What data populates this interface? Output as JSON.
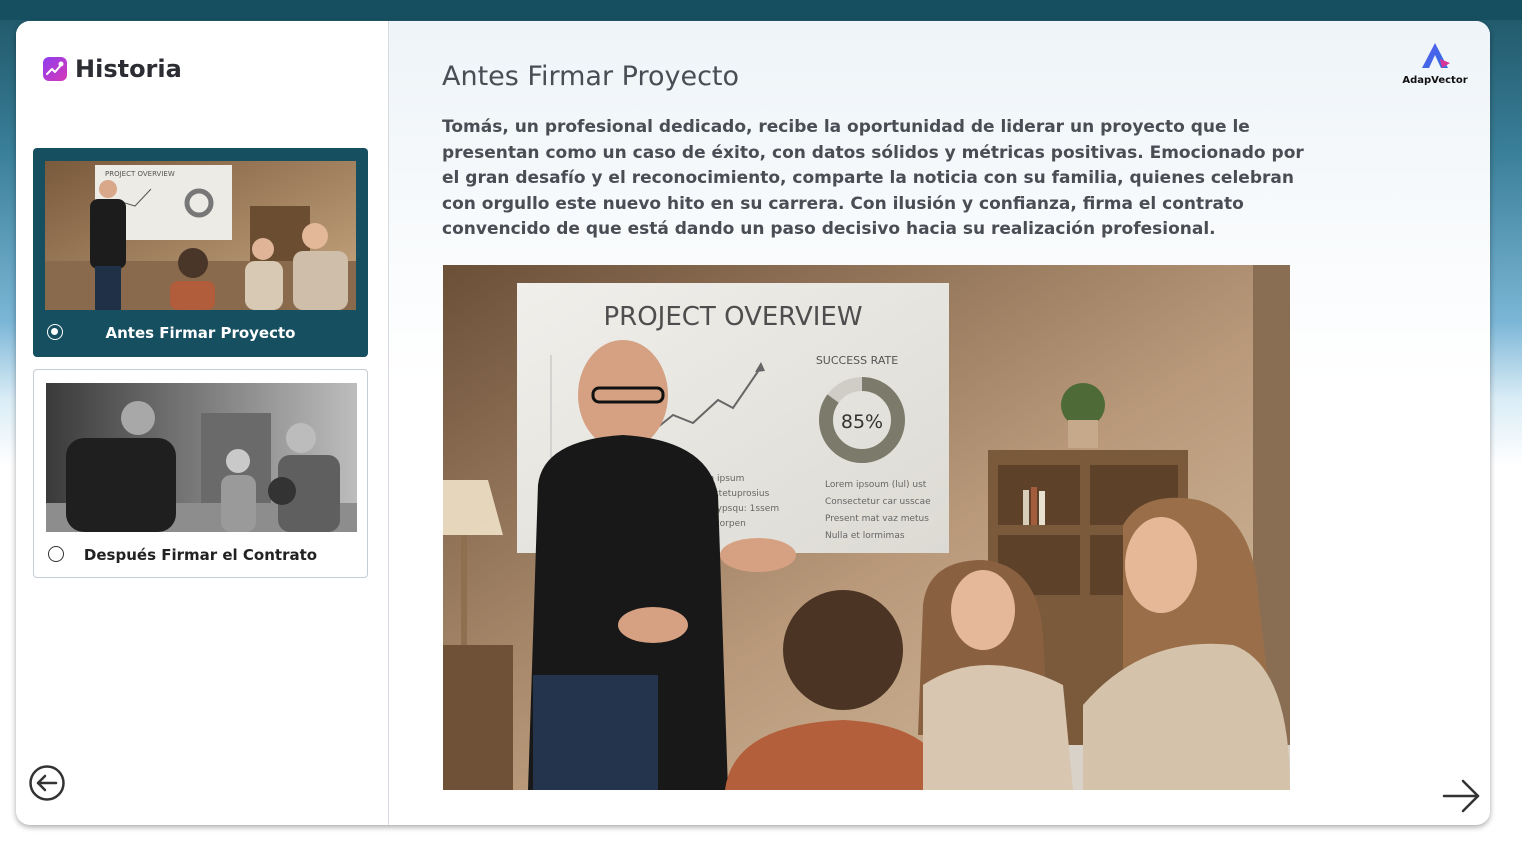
{
  "app": {
    "title": "Historia"
  },
  "scenes": [
    {
      "label": "Antes Firmar Proyecto",
      "selected": true,
      "thumbnail": "man-presenting-project-overview-to-family"
    },
    {
      "label": "Después Firmar el Contrato",
      "selected": false,
      "thumbnail": "man-worried-with-family-grayscale"
    }
  ],
  "main": {
    "title": "Antes Firmar Proyecto",
    "description": "Tomás, un profesional dedicado, recibe la oportunidad de liderar un proyecto que le presentan como un caso de éxito, con datos sólidos y métricas positivas. Emocionado por el gran desafío y el reconocimiento, comparte la noticia con su familia, quienes celebran con orgullo este nuevo hito en su carrera. Con ilusión y confianza, firma el contrato convencido de que está dando un paso decisivo hacia su realización profesional.",
    "image": "man-presenting-project-overview-to-family",
    "slide": {
      "heading": "PROJECT OVERVIEW",
      "success_label": "SUCCESS RATE",
      "success_value": "85%",
      "success_fraction": 0.85,
      "bullets_left": [
        "Lorem ipsum",
        "Consectetuprosius",
        "Patlon ypsqu: 1ssem",
        "Ullam corpen"
      ],
      "bullets_right": [
        "Lorem ipsoum (lul) ust",
        "Consectetur car usscae",
        "Present mat vaz metus",
        "Nulla et lormimas"
      ]
    }
  },
  "logo": {
    "text": "AdapVector"
  },
  "navigation": {
    "back": "back-arrow-icon",
    "next": "next-arrow-icon"
  },
  "colors": {
    "accent": "#164f60",
    "brand_gradient_start": "#8f3cf0",
    "brand_gradient_end": "#d63ab7"
  }
}
